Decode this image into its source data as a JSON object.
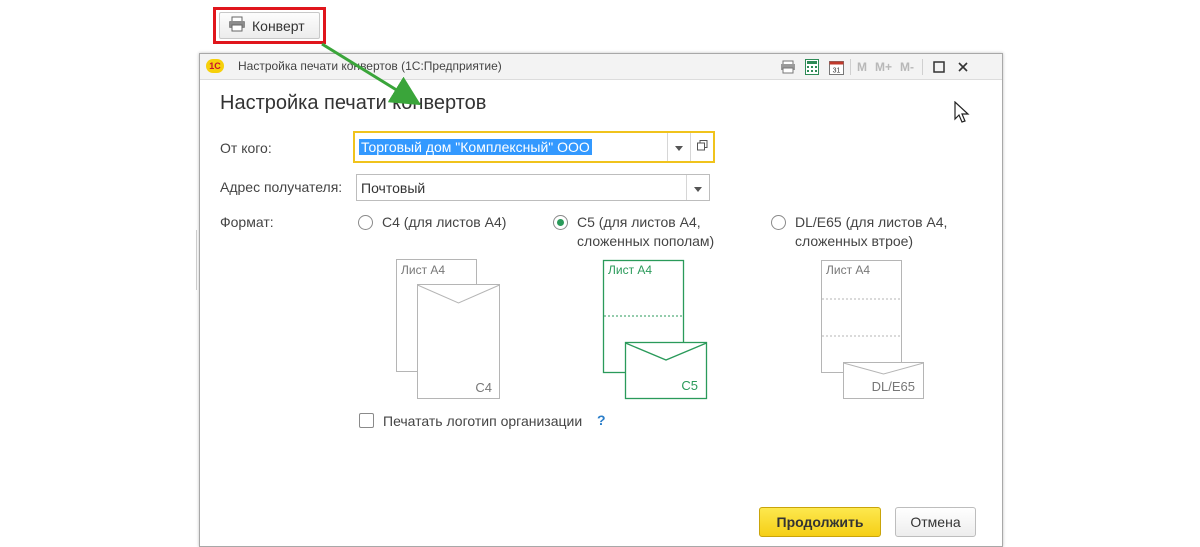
{
  "toolbar_button": {
    "label": "Конверт",
    "icon": "printer-icon"
  },
  "window": {
    "title": "Настройка печати конвертов  (1С:Предприятие)",
    "app_logo": "1С",
    "controls": {
      "m": "M",
      "m_plus": "M+",
      "m_minus": "M-"
    }
  },
  "form": {
    "heading": "Настройка печати конвертов",
    "from_label": "От кого:",
    "from_value": "Торговый дом \"Комплексный\" ООО",
    "address_label": "Адрес получателя:",
    "address_value": "Почтовый",
    "format_label": "Формат:",
    "formats": [
      {
        "line1": "C4 (для листов А4)",
        "line2": "",
        "checked": false,
        "sheet_label": "Лист А4",
        "envelope_label": "C4"
      },
      {
        "line1": "C5 (для листов А4,",
        "line2": "сложенных пополам)",
        "checked": true,
        "sheet_label": "Лист А4",
        "envelope_label": "C5"
      },
      {
        "line1": "DL/E65 (для листов А4,",
        "line2": "сложенных втрое)",
        "checked": false,
        "sheet_label": "Лист А4",
        "envelope_label": "DL/E65"
      }
    ],
    "print_logo_label": "Печатать логотип организации",
    "print_logo_checked": false,
    "help": "?"
  },
  "buttons": {
    "continue": "Продолжить",
    "cancel": "Отмена"
  },
  "colors": {
    "highlight": "#e0161c",
    "accent_green": "#2a9a5a",
    "arrow_green": "#3aa53a",
    "focus": "#f0c31c",
    "primary_button": "#f5cf16"
  }
}
